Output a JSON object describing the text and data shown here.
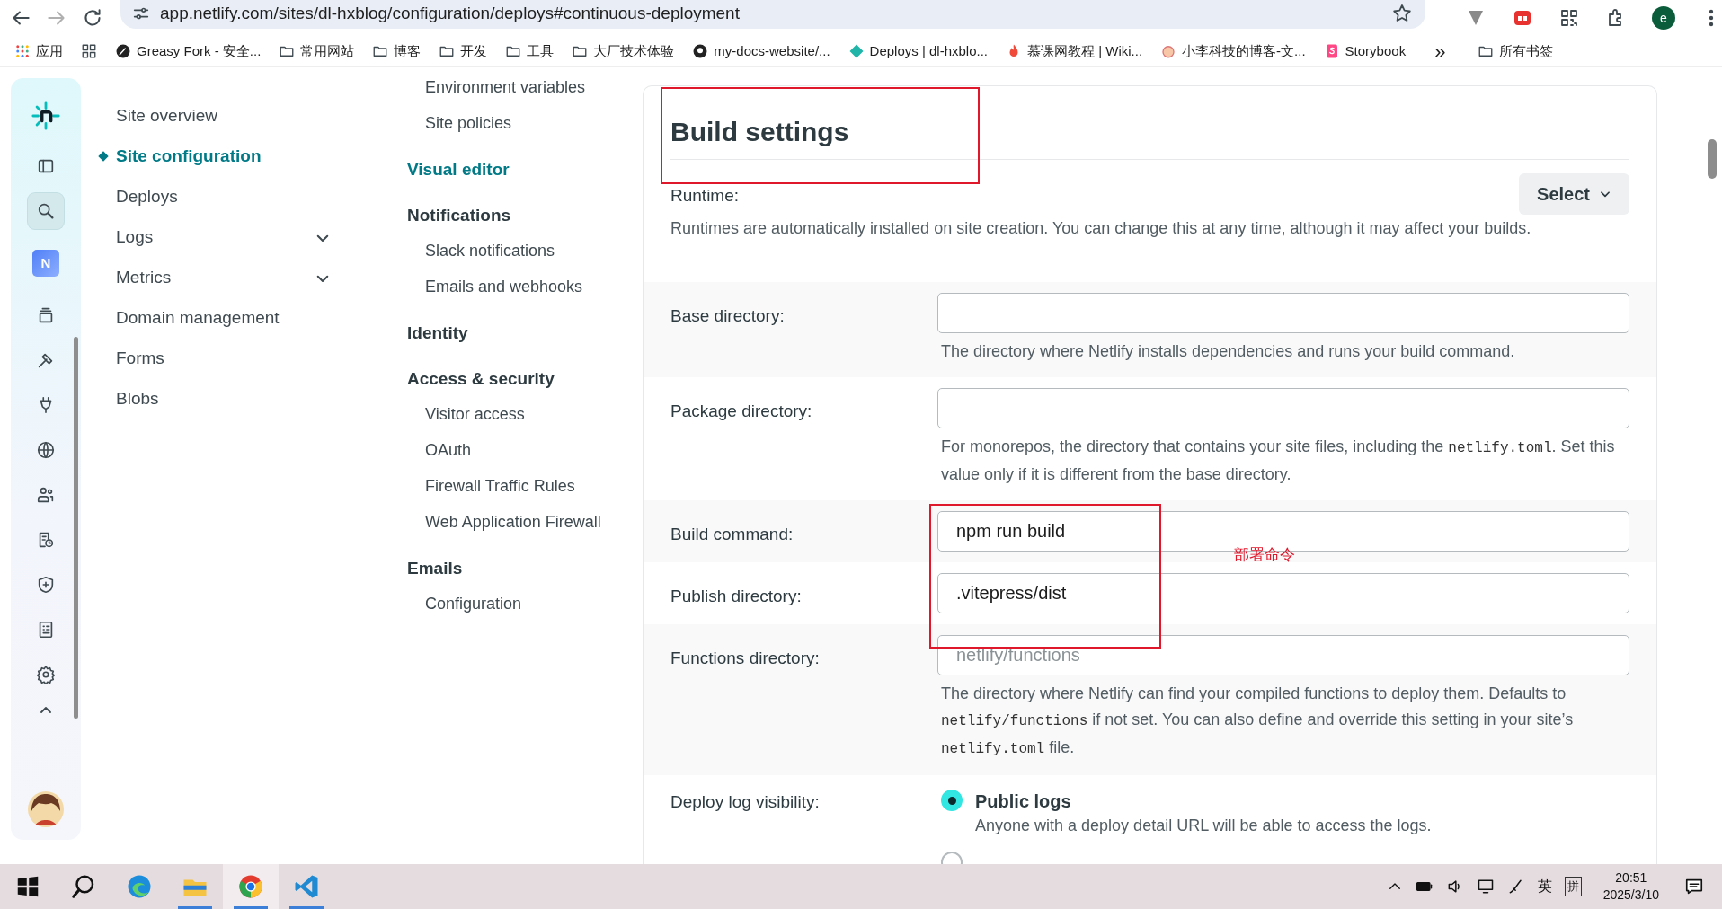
{
  "browser": {
    "url": "app.netlify.com/sites/dl-hxblog/configuration/deploys#continuous-deployment",
    "profile_initial": "e",
    "bookmarks": [
      {
        "kind": "apps",
        "label": "应用"
      },
      {
        "kind": "grid"
      },
      {
        "kind": "greasy",
        "label": "Greasy Fork - 安全..."
      },
      {
        "kind": "folder",
        "label": "常用网站"
      },
      {
        "kind": "folder",
        "label": "博客"
      },
      {
        "kind": "folder",
        "label": "开发"
      },
      {
        "kind": "folder",
        "label": "工具"
      },
      {
        "kind": "folder",
        "label": "大厂技术体验"
      },
      {
        "kind": "github",
        "label": "my-docs-website/..."
      },
      {
        "kind": "diamond",
        "label": "Deploys | dl-hxblo..."
      },
      {
        "kind": "flame",
        "label": "慕课网教程 | Wiki..."
      },
      {
        "kind": "peach",
        "label": "小李科技的博客-文..."
      },
      {
        "kind": "storybook",
        "label": "Storybook"
      },
      {
        "kind": "more",
        "label": "»"
      },
      {
        "kind": "folder",
        "label": "所有书签"
      }
    ]
  },
  "rail": {
    "items": [
      {
        "kind": "logo",
        "selected": false
      },
      {
        "kind": "panel",
        "selected": false
      },
      {
        "kind": "search",
        "selected": true
      },
      {
        "kind": "team",
        "label": "N",
        "selected": false
      },
      {
        "kind": "stack",
        "selected": false
      },
      {
        "kind": "hammer",
        "selected": false
      },
      {
        "kind": "plug",
        "selected": false
      },
      {
        "kind": "globe",
        "selected": false
      },
      {
        "kind": "people",
        "selected": false
      },
      {
        "kind": "log",
        "selected": false
      },
      {
        "kind": "shield",
        "selected": false
      },
      {
        "kind": "receipt",
        "selected": false
      },
      {
        "kind": "gear",
        "selected": false
      },
      {
        "kind": "caret",
        "selected": false
      }
    ]
  },
  "side_nav": {
    "items": [
      {
        "label": "Site overview",
        "selected": false,
        "expandable": false
      },
      {
        "label": "Site configuration",
        "selected": true,
        "expandable": false
      },
      {
        "label": "Deploys",
        "selected": false,
        "expandable": false
      },
      {
        "label": "Logs",
        "selected": false,
        "expandable": true
      },
      {
        "label": "Metrics",
        "selected": false,
        "expandable": true
      },
      {
        "label": "Domain management",
        "selected": false,
        "expandable": false
      },
      {
        "label": "Forms",
        "selected": false,
        "expandable": false
      },
      {
        "label": "Blobs",
        "selected": false,
        "expandable": false
      }
    ]
  },
  "sub_nav": {
    "items": [
      {
        "kind": "item",
        "label": "Environment variables"
      },
      {
        "kind": "item",
        "label": "Site policies"
      },
      {
        "kind": "heading-link",
        "label": "Visual editor"
      },
      {
        "kind": "heading",
        "label": "Notifications"
      },
      {
        "kind": "item",
        "label": "Slack notifications"
      },
      {
        "kind": "item",
        "label": "Emails and webhooks"
      },
      {
        "kind": "heading",
        "label": "Identity"
      },
      {
        "kind": "heading",
        "label": "Access & security"
      },
      {
        "kind": "item",
        "label": "Visitor access"
      },
      {
        "kind": "item",
        "label": "OAuth"
      },
      {
        "kind": "item",
        "label": "Firewall Traffic Rules"
      },
      {
        "kind": "item",
        "label": "Web Application Firewall"
      },
      {
        "kind": "heading",
        "label": "Emails"
      },
      {
        "kind": "item",
        "label": "Configuration"
      }
    ]
  },
  "build_settings": {
    "title": "Build settings",
    "runtime": {
      "label": "Runtime:",
      "button": "Select",
      "description": "Runtimes are automatically installed on site creation. You can change this at any time, although it may affect your builds."
    },
    "fields": [
      {
        "label": "Base directory:",
        "help": [
          {
            "kind": "text",
            "text": "The directory where Netlify installs dependencies and runs your build command."
          }
        ]
      },
      {
        "label": "Package directory:",
        "help": [
          {
            "kind": "text",
            "text": "For monorepos, the directory that contains your site files, including the "
          },
          {
            "kind": "code",
            "text": "netlify.toml"
          },
          {
            "kind": "text",
            "text": ". Set this value only if it is different from the base directory."
          }
        ]
      },
      {
        "label": "Build command:",
        "value": "npm run build"
      },
      {
        "label": "Publish directory:",
        "value": ".vitepress/dist"
      },
      {
        "label": "Functions directory:",
        "placeholder": "netlify/functions",
        "help": [
          {
            "kind": "text",
            "text": "The directory where Netlify can find your compiled functions to deploy them. Defaults to "
          },
          {
            "kind": "code",
            "text": "netlify/functions"
          },
          {
            "kind": "text",
            "text": " if not set. You can also define and override this setting in your site’s "
          },
          {
            "kind": "code",
            "text": "netlify.toml"
          },
          {
            "kind": "text",
            "text": " file."
          }
        ]
      }
    ],
    "deploy_log": {
      "label": "Deploy log visibility:",
      "options": [
        {
          "label": "Public logs",
          "description": "Anyone with a deploy detail URL will be able to access the logs.",
          "selected": true
        },
        {
          "selected": false
        }
      ]
    }
  },
  "annotations": [
    {
      "kind": "box"
    },
    {
      "kind": "box"
    },
    {
      "kind": "note",
      "text": "部署命令"
    }
  ],
  "taskbar": {
    "apps": [
      {
        "kind": "windows",
        "running": false,
        "selected": false
      },
      {
        "kind": "search",
        "running": false,
        "selected": false
      },
      {
        "kind": "edge",
        "running": false,
        "selected": false
      },
      {
        "kind": "explorer",
        "running": true,
        "selected": false
      },
      {
        "kind": "chrome",
        "running": true,
        "selected": true
      },
      {
        "kind": "vscode",
        "running": true,
        "selected": false
      }
    ],
    "tray": {
      "ime_lang": "英",
      "ime_mode": "拼",
      "time": "20:51",
      "date": "2025/3/10"
    }
  }
}
